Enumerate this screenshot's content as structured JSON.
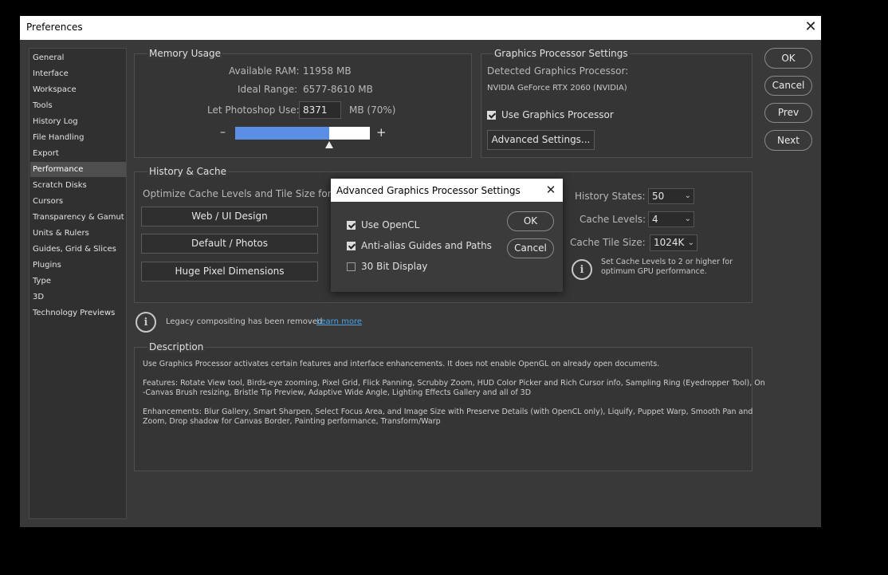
{
  "window": {
    "title": "Preferences",
    "close_glyph": "✕"
  },
  "sidebar": {
    "items": [
      {
        "label": "General"
      },
      {
        "label": "Interface"
      },
      {
        "label": "Workspace"
      },
      {
        "label": "Tools"
      },
      {
        "label": "History Log"
      },
      {
        "label": "File Handling"
      },
      {
        "label": "Export"
      },
      {
        "label": "Performance"
      },
      {
        "label": "Scratch Disks"
      },
      {
        "label": "Cursors"
      },
      {
        "label": "Transparency & Gamut"
      },
      {
        "label": "Units & Rulers"
      },
      {
        "label": "Guides, Grid & Slices"
      },
      {
        "label": "Plugins"
      },
      {
        "label": "Type"
      },
      {
        "label": "3D"
      },
      {
        "label": "Technology Previews"
      }
    ],
    "active": "Performance"
  },
  "memory": {
    "title": "Memory Usage",
    "available_label": "Available RAM:",
    "available_value": "11958 MB",
    "ideal_label": "Ideal Range:",
    "ideal_value": "6577-8610 MB",
    "let_label": "Let Photoshop Use:",
    "let_value": "8371",
    "let_unit": "MB (70%)",
    "minus": "–",
    "plus": "+",
    "slider_fraction": 0.7,
    "slider_color": "#5b8fe6"
  },
  "gpu": {
    "title": "Graphics Processor Settings",
    "detected_label": "Detected Graphics Processor:",
    "detected_value": "NVIDIA GeForce RTX 2060 (NVIDIA)",
    "use_label": "Use Graphics Processor",
    "use_checked": true,
    "advanced_button": "Advanced Settings..."
  },
  "actions": {
    "ok": "OK",
    "cancel": "Cancel",
    "prev": "Prev",
    "next": "Next"
  },
  "history": {
    "title": "History & Cache",
    "optimize_label": "Optimize Cache Levels and Tile Size for:",
    "buttons": [
      "Web / UI Design",
      "Default / Photos",
      "Huge Pixel Dimensions"
    ],
    "states_label": "History States:",
    "states_value": "50",
    "levels_label": "Cache Levels:",
    "levels_value": "4",
    "tile_label": "Cache Tile Size:",
    "tile_value": "1024K",
    "tip_line1": "Set Cache Levels to 2 or higher for",
    "tip_line2": "optimum GPU performance."
  },
  "legacy": {
    "text": "Legacy compositing has been removed",
    "link": "Learn more",
    "link_color": "#4aa3e8"
  },
  "description": {
    "title": "Description",
    "p1": "Use Graphics Processor activates certain features and interface enhancements. It does not enable OpenGL on already open documents.",
    "p2a": "Features: Rotate View tool, Birds-eye zooming, Pixel Grid, Flick Panning, Scrubby Zoom, HUD Color Picker and Rich Cursor info, Sampling Ring (Eyedropper Tool), On",
    "p2b": "-Canvas Brush resizing, Bristle Tip Preview, Adaptive Wide Angle, Lighting Effects Gallery and all of 3D",
    "p3a": "Enhancements: Blur Gallery, Smart Sharpen, Select Focus Area, and Image Size with Preserve Details (with OpenCL only), Liquify, Puppet Warp, Smooth Pan and",
    "p3b": "Zoom, Drop shadow for Canvas Border, Painting performance, Transform/Warp"
  },
  "dialog": {
    "title": "Advanced Graphics Processor Settings",
    "close_glyph": "✕",
    "options": [
      {
        "label": "Use OpenCL",
        "checked": true
      },
      {
        "label": "Anti-alias Guides and Paths",
        "checked": true
      },
      {
        "label": "30 Bit Display",
        "checked": false
      }
    ],
    "ok": "OK",
    "cancel": "Cancel"
  }
}
